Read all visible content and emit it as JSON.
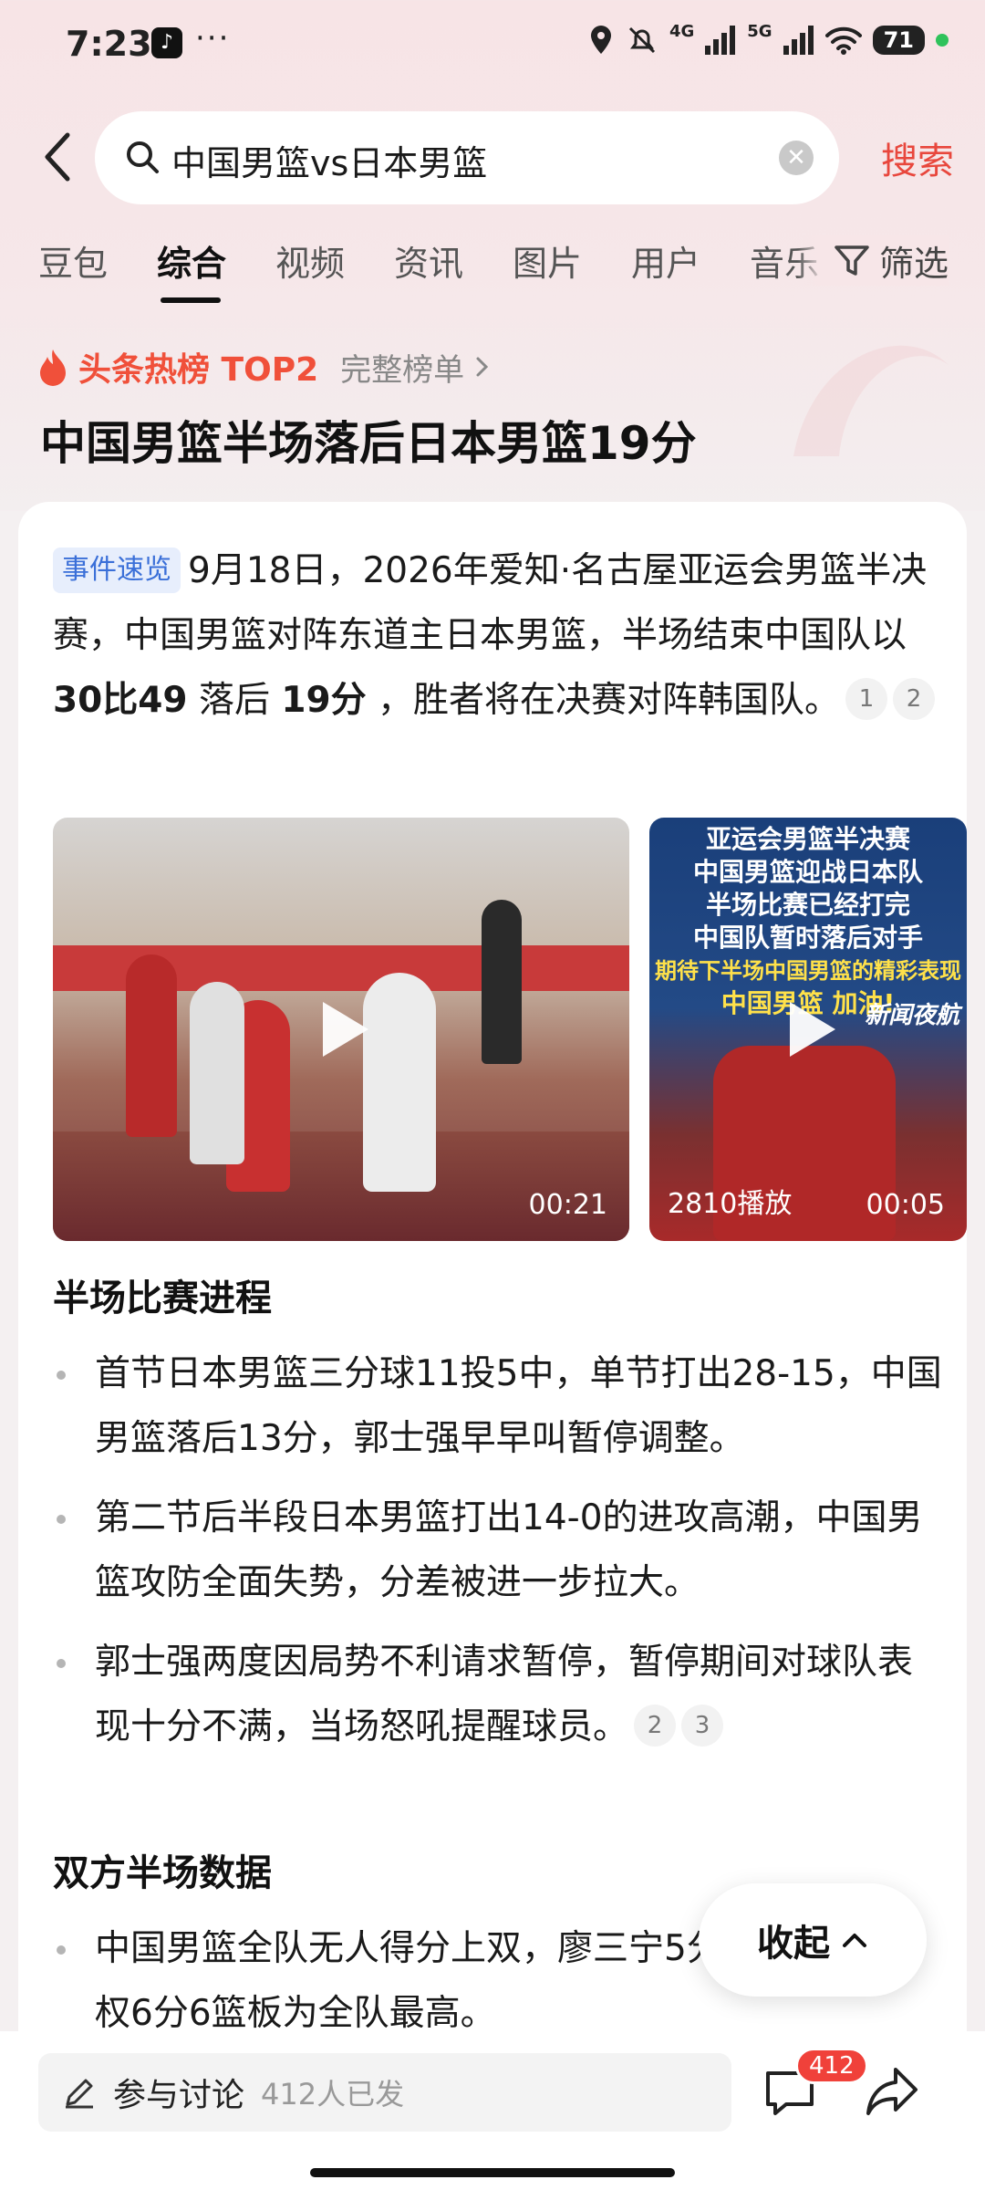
{
  "status_bar": {
    "time": "7:23",
    "more": "···",
    "network_4g": "4G",
    "network_5g": "5G",
    "battery": "71"
  },
  "search": {
    "query": "中国男篮vs日本男篮",
    "submit_label": "搜索"
  },
  "tabs": [
    {
      "label": "豆包"
    },
    {
      "label": "综合"
    },
    {
      "label": "视频"
    },
    {
      "label": "资讯"
    },
    {
      "label": "图片"
    },
    {
      "label": "用户"
    },
    {
      "label": "音乐"
    }
  ],
  "filter_label": "筛选",
  "hot_rank": {
    "label": "头条热榜 TOP2",
    "full_list": "完整榜单"
  },
  "title": "中国男篮半场落后日本男篮19分",
  "summary": {
    "tag": "事件速览",
    "text_1": "9月18日，2026年爱知·名古屋亚运会男篮半决赛，中国男篮对阵东道主日本男篮，半场结束中国队以 ",
    "bold_1": "30比49",
    "text_2": " 落后 ",
    "bold_2": "19分",
    "text_3": " ，胜者将在决赛对阵韩国队。",
    "refs": [
      "1",
      "2"
    ]
  },
  "videos": [
    {
      "duration": "00:21"
    },
    {
      "duration": "00:05",
      "plays": "2810播放",
      "caption_lines": [
        "亚运会男篮半决赛",
        "中国男篮迎战日本队",
        "半场比赛已经打完",
        "中国队暂时落后对手",
        "期待下半场中国男篮的精彩表现",
        "中国男篮 加油!"
      ],
      "brand": "新闻夜航"
    }
  ],
  "section_progress": {
    "title": "半场比赛进程",
    "items": [
      "首节日本男篮三分球11投5中，单节打出28-15，中国男篮落后13分，郭士强早早叫暂停调整。",
      "第二节后半段日本男篮打出14-0的进攻高潮，中国男篮攻防全面失势，分差被进一步拉大。",
      "郭士强两度因局势不利请求暂停，暂停期间对球队表现十分不满，当场怒吼提醒球员。"
    ],
    "refs": [
      "2",
      "3"
    ]
  },
  "section_stats": {
    "title": "双方半场数据",
    "items": [
      "中国男篮全队无人得分上双，廖三宁5分3篮板，李弘权6分6篮板为全队最高。"
    ]
  },
  "collapse_label": "收起",
  "bottom_bar": {
    "discuss_label": "参与讨论",
    "discuss_count": "412人已发",
    "comment_badge": "412"
  }
}
